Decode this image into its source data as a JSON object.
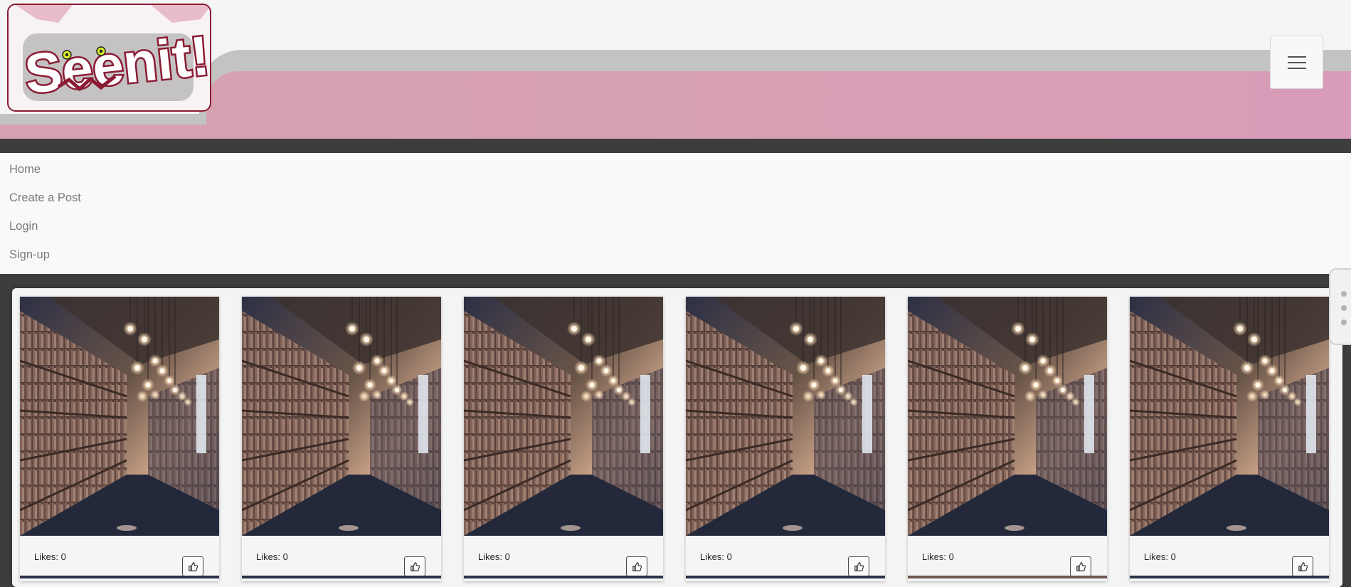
{
  "site": {
    "logo_text": "Seenit!"
  },
  "nav": {
    "items": [
      {
        "label": "Home"
      },
      {
        "label": "Create a Post"
      },
      {
        "label": "Login"
      },
      {
        "label": "Sign-up"
      }
    ]
  },
  "posts": [
    {
      "likes_label": "Likes: 0"
    },
    {
      "likes_label": "Likes: 0"
    },
    {
      "likes_label": "Likes: 0"
    },
    {
      "likes_label": "Likes: 0"
    },
    {
      "likes_label": "Likes: 0"
    },
    {
      "likes_label": "Likes: 0"
    }
  ],
  "icons": {
    "menu": "hamburger-icon",
    "like": "thumbs-up-icon",
    "side_handle": "more-vertical-icon"
  },
  "colors": {
    "brand_maroon": "#8a1b33",
    "header_pink": "#d6a2b1",
    "header_gray": "#c3c3c3",
    "page_dark": "#3d3d3d"
  }
}
